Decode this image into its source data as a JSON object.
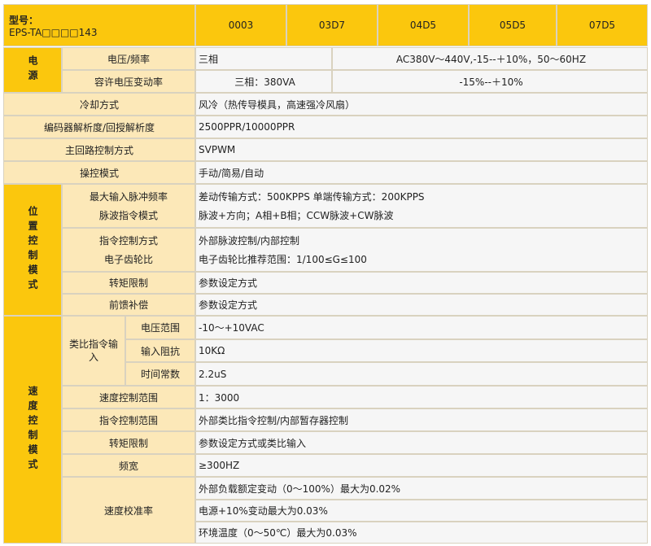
{
  "header": {
    "model_label": "型号：",
    "model_code": "EPS-TA□□□□143",
    "variants": [
      "0003",
      "03D7",
      "04D5",
      "05D5",
      "07D5"
    ]
  },
  "power": {
    "category": "电源",
    "voltage_freq_label": "电压/频率",
    "voltage_freq_phase": "三相",
    "voltage_freq_range": "AC380V～440V,-15--＋10%，50～60HZ",
    "tolerance_label": "容许电压变动率",
    "tolerance_phase": "三相：380VA",
    "tolerance_range": "-15%--＋10%"
  },
  "general": [
    {
      "label": "冷却方式",
      "value": "风冷（热传导模具，高速强冷风扇）"
    },
    {
      "label": "编码器解析度/回授解析度",
      "value": "2500PPR/10000PPR"
    },
    {
      "label": "主回路控制方式",
      "value": "SVPWM"
    },
    {
      "label": "操控模式",
      "value": "手动/简易/自动"
    }
  ],
  "position": {
    "category": "位置控制模式",
    "group1_labels": [
      "最大输入脉冲频率",
      "脉波指令模式"
    ],
    "group1_values": [
      "差动传输方式：500KPPS  单端传输方式：200KPPS",
      "脉波+方向；A相+B相；CCW脉波+CW脉波"
    ],
    "group2_labels": [
      "指令控制方式",
      "电子齿轮比"
    ],
    "group2_values": [
      "外部脉波控制/内部控制",
      "电子齿轮比推荐范围：1/100≤G≤100"
    ],
    "torque_limit_label": "转矩限制",
    "torque_limit_value": "参数设定方式",
    "feedforward_label": "前馈补偿",
    "feedforward_value": "参数设定方式"
  },
  "speed": {
    "category": "速度控制模式",
    "analog_label": "类比指令输入",
    "analog_rows": [
      {
        "label": "电压范围",
        "value": "-10～+10VAC"
      },
      {
        "label": "输入阻抗",
        "value": "10KΩ"
      },
      {
        "label": "时间常数",
        "value": "2.2uS"
      }
    ],
    "rows": [
      {
        "label": "速度控制范围",
        "value": "1：3000"
      },
      {
        "label": "指令控制范围",
        "value": "外部类比指令控制/内部暂存器控制"
      },
      {
        "label": "转矩限制",
        "value": "参数设定方式或类比输入"
      },
      {
        "label": "频宽",
        "value": "≥300HZ"
      }
    ],
    "accuracy_label": "速度校准率",
    "accuracy_values": [
      "外部负载额定变动（0～100%）最大为0.02%",
      "电源+10%变动最大为0.03%",
      "环境温度（0～50℃）最大为0.03%"
    ]
  }
}
